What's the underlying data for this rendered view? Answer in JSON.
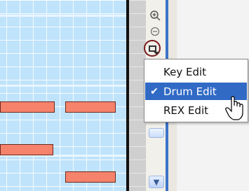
{
  "toolbar": {
    "zoom_in_icon": "zoom-in-icon",
    "zoom_out_icon": "zoom-out-icon",
    "edit_mode_icon": "edit-mode-icon"
  },
  "menu": {
    "items": [
      {
        "label": "Key Edit",
        "checked": false,
        "selected": false
      },
      {
        "label": "Drum Edit",
        "checked": true,
        "selected": true
      },
      {
        "label": "REX Edit",
        "checked": false,
        "selected": false
      }
    ],
    "check_glyph": "✔"
  },
  "colors": {
    "grid": "#bfe3fb",
    "note": "#f5826b",
    "menu_highlight": "#316ac5",
    "frame": "#3b73c8"
  }
}
